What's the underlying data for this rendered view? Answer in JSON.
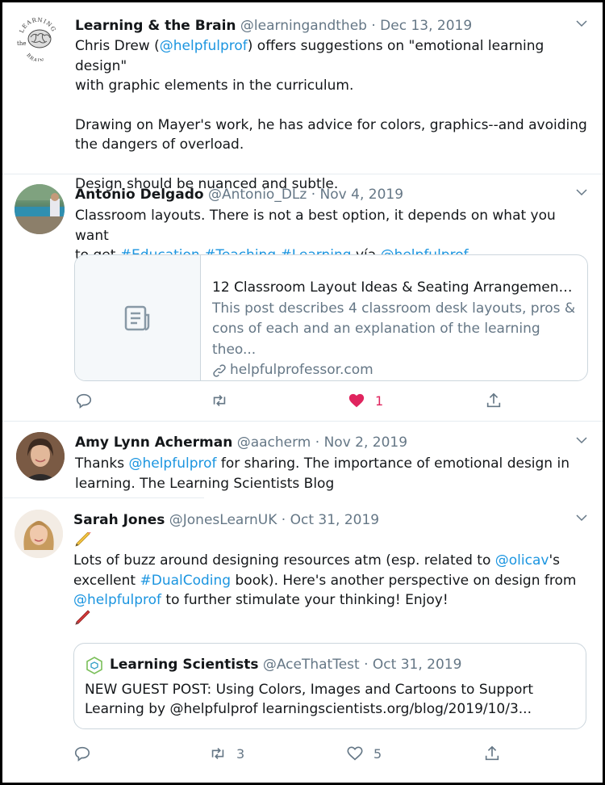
{
  "tweets": [
    {
      "name": "Learning & the Brain",
      "handle": "@learningandtheb",
      "sep": "·",
      "date": "Dec 13, 2019",
      "lines": [
        {
          "pre": "Chris Drew (",
          "link": "@helpfulprof",
          "post": ") offers suggestions on \"emotional learning design\""
        },
        {
          "text": "with graphic elements in the curriculum."
        },
        {
          "text": "Drawing on Mayer's work, he has advice for colors, graphics--and avoiding"
        },
        {
          "text": "the dangers of overload."
        },
        {
          "text": "Design should be nuanced and subtle."
        }
      ],
      "avatar_text": {
        "top": "LEARNING",
        "left": "the",
        "bottom": "BRAIN"
      }
    },
    {
      "name": "Antonio Delgado",
      "handle": "@Antonio_DLz",
      "sep": "·",
      "date": "Nov 4, 2019",
      "line1": "Classroom layouts. There is not a best option, it depends on what you want",
      "line2_pre": "to get ",
      "line2_tags": "#Education #Teaching #Learning",
      "line2_mid": " vía ",
      "line2_link": "@helpfulprof",
      "card": {
        "title": "12 Classroom Layout Ideas & Seating Arrangements ...",
        "desc1": "This post describes 4 classroom desk layouts, pros &",
        "desc2": "cons of each and an explanation of the learning theo...",
        "domain": "helpfulprofessor.com"
      },
      "likes": "1"
    },
    {
      "name": "Amy Lynn Acherman",
      "handle": "@aacherm",
      "sep": "·",
      "date": "Nov 2, 2019",
      "line1_pre": "Thanks ",
      "line1_link": "@helpfulprof",
      "line1_post": " for sharing. The importance of emotional design in",
      "line2": "learning. The Learning Scientists Blog"
    },
    {
      "name": "Sarah Jones",
      "handle": "@JonesLearnUK",
      "sep": "·",
      "date": "Oct 31, 2019",
      "line1": "Lots of buzz around designing resources atm (esp. related to ",
      "line1_link": "@olicav",
      "line1_post": "'s",
      "line2_pre": "excellent ",
      "line2_tag": "#DualCoding",
      "line2_post": " book). Here's another perspective on design from",
      "line3_link": "@helpfulprof",
      "line3_post": " to further stimulate your thinking! Enjoy!",
      "quote": {
        "name": "Learning Scientists",
        "handle": "@AceThatTest",
        "sep": "·",
        "date": "Oct 31, 2019",
        "line1": "NEW GUEST POST: Using Colors, Images and Cartoons to Support",
        "line2": "Learning by @helpfulprof  learningscientists.org/blog/2019/10/3..."
      },
      "retweets": "3",
      "likes": "5"
    }
  ],
  "colors": {
    "link": "#1b95e0",
    "secondary": "#657786",
    "like_active": "#e0245e",
    "border": "#ccd6dd"
  }
}
